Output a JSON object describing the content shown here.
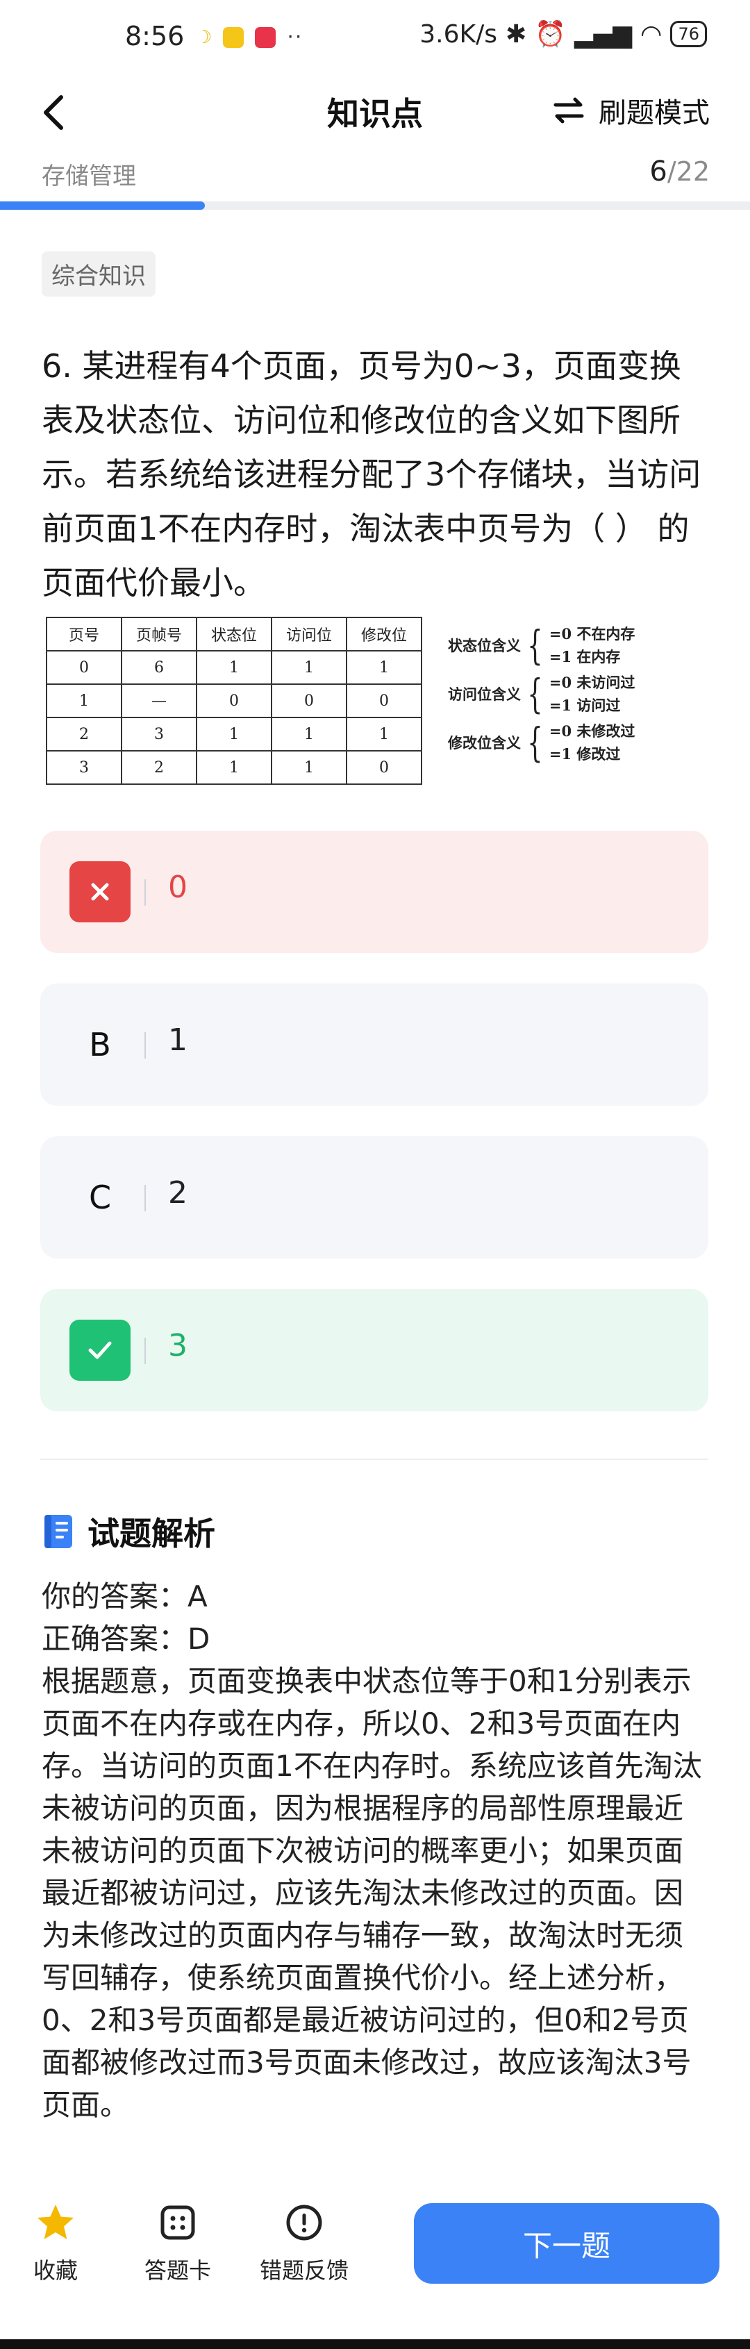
{
  "status": {
    "time": "8:56",
    "network_speed": "3.6K/s",
    "battery": "76",
    "dots": "··"
  },
  "header": {
    "title": "知识点",
    "mode_label": "刷题模式"
  },
  "subheader": {
    "chapter": "存储管理",
    "current": "6",
    "total": "/22",
    "progress_fraction": 0.2727
  },
  "tag": "综合知识",
  "question": {
    "text": "6. 某进程有4个页面，页号为0~3，页面变换表及状态位、访问位和修改位的含义如下图所示。若系统给该进程分配了3个存储块，当访问前页面1不在内存时，淘汰表中页号为（ ） 的页面代价最小。"
  },
  "figure": {
    "headers": [
      "页号",
      "页帧号",
      "状态位",
      "访问位",
      "修改位"
    ],
    "rows": [
      [
        "0",
        "6",
        "1",
        "1",
        "1"
      ],
      [
        "1",
        "—",
        "0",
        "0",
        "0"
      ],
      [
        "2",
        "3",
        "1",
        "1",
        "1"
      ],
      [
        "3",
        "2",
        "1",
        "1",
        "0"
      ]
    ],
    "legend": [
      {
        "name": "状态位含义",
        "v0": "=0 不在内存",
        "v1": "=1 在内存"
      },
      {
        "name": "访问位含义",
        "v0": "=0 未访问过",
        "v1": "=1 访问过"
      },
      {
        "name": "修改位含义",
        "v0": "=0 未修改过",
        "v1": "=1 修改过"
      }
    ]
  },
  "options": [
    {
      "key": "",
      "text": "0",
      "state": "wrong"
    },
    {
      "key": "B",
      "text": "1",
      "state": "normal"
    },
    {
      "key": "C",
      "text": "2",
      "state": "normal"
    },
    {
      "key": "",
      "text": "3",
      "state": "correct"
    }
  ],
  "analysis": {
    "heading": "试题解析",
    "your_answer": "你的答案：A",
    "correct_answer": "正确答案：D",
    "body": "根据题意，页面变换表中状态位等于0和1分别表示页面不在内存或在内存，所以0、2和3号页面在内存。当访问的页面1不在内存时。系统应该首先淘汰未被访问的页面，因为根据程序的局部性原理最近未被访问的页面下次被访问的概率更小；如果页面最近都被访问过，应该先淘汰未修改过的页面。因为未修改过的页面内存与辅存一致，故淘汰时无须写回辅存，使系统页面置换代价小。经上述分析，0、2和3号页面都是最近被访问过的，但0和2号页面都被修改过而3号页面未修改过，故应该淘汰3号页面。"
  },
  "bottom": {
    "favorite": "收藏",
    "answer_card": "答题卡",
    "feedback": "错题反馈",
    "next": "下一题"
  },
  "colors": {
    "accent": "#3b82f6",
    "wrong": "#e54545",
    "correct": "#1fc174",
    "star": "#f5b800"
  }
}
